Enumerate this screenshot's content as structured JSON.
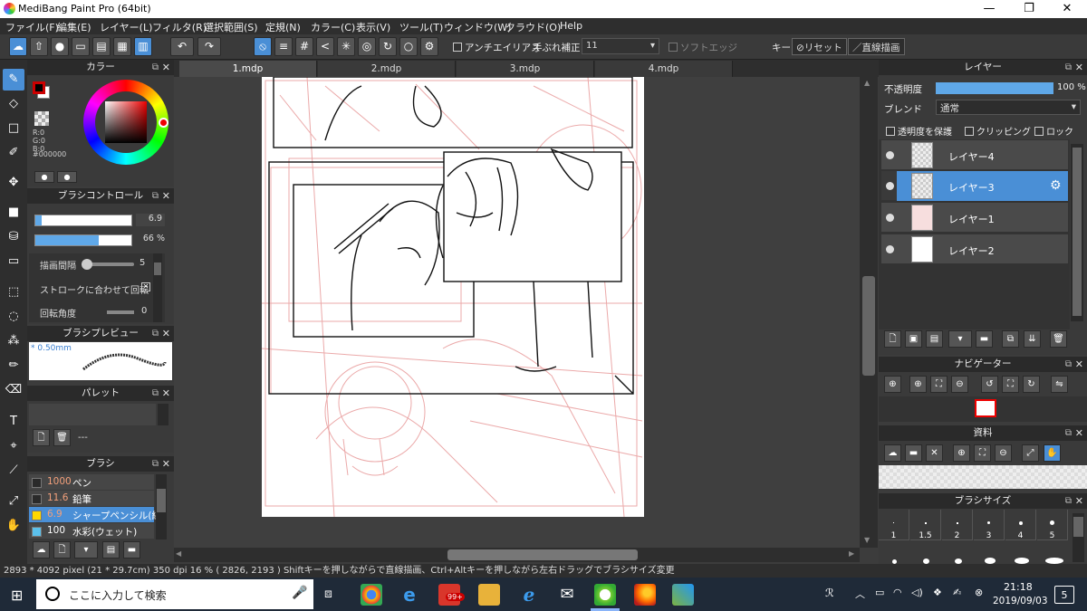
{
  "window": {
    "title": "MediBang Paint Pro (64bit)",
    "minimize": "—",
    "maximize": "❐",
    "close": "✕"
  },
  "menu": [
    "ファイル(F)",
    "編集(E)",
    "レイヤー(L)",
    "フィルタ(R)",
    "選択範囲(S)",
    "定規(N)",
    "カラー(C)",
    "表示(V)",
    "ツール(T)",
    "ウィンドウ(W)",
    "クラウド(O)",
    "Help"
  ],
  "toolbar": {
    "antialias": "アンチエイリアス",
    "stabilizer_label": "手ぶれ補正",
    "stabilizer_value": "11",
    "soft_edge": "ソフトエッジ",
    "key_label": "キー",
    "reset": "リセット",
    "line_draw": "直線描画"
  },
  "tabs": [
    "1.mdp",
    "2.mdp",
    "3.mdp",
    "4.mdp"
  ],
  "color_panel": {
    "title": "カラー",
    "r": "R:0",
    "g": "G:0",
    "b": "B:0",
    "hex": "#000000",
    "foreground": "#cc0000",
    "background": "#ffffff"
  },
  "brush_control": {
    "title": "ブラシコントロール",
    "size": "6.9",
    "opacity": "66",
    "opacity_unit": "%",
    "opacity_fraction": 0.66,
    "size_fraction": 0.07,
    "spacing_label": "描画間隔",
    "spacing_value": "5",
    "rotate_label": "ストロークに合わせて回転",
    "angle_label": "回転角度",
    "angle_value": "0"
  },
  "brush_preview": {
    "title": "ブラシプレビュー",
    "size_label": "* 0.50mm"
  },
  "palette": {
    "title": "パレット",
    "dash": "---"
  },
  "brush_list": {
    "title": "ブラシ",
    "items": [
      {
        "size": "1000",
        "name": "ペン",
        "color": "#2a2a2a"
      },
      {
        "size": "11.6",
        "name": "鉛筆",
        "color": "#2a2a2a"
      },
      {
        "size": "6.9",
        "name": "シャープペンシル(線)",
        "color": "#ffd700"
      },
      {
        "size": "100",
        "name": "水彩(ウェット)",
        "color": "#5bc0eb"
      }
    ]
  },
  "layers": {
    "title": "レイヤー",
    "opacity_label": "不透明度",
    "opacity_value": "100",
    "opacity_unit": "%",
    "opacity_fraction": 1.0,
    "blend_label": "ブレンド",
    "blend_value": "通常",
    "protect": "透明度を保護",
    "clipping": "クリッピング",
    "lock": "ロック",
    "items": [
      {
        "name": "レイヤー4",
        "selected": false
      },
      {
        "name": "レイヤー3",
        "selected": true
      },
      {
        "name": "レイヤー1",
        "selected": false
      },
      {
        "name": "レイヤー2",
        "selected": false
      }
    ]
  },
  "navigator": {
    "title": "ナビゲーター"
  },
  "material": {
    "title": "資料"
  },
  "brush_size": {
    "title": "ブラシサイズ",
    "sizes": [
      "1",
      "1.5",
      "2",
      "3",
      "4",
      "5"
    ]
  },
  "status": {
    "text": "2893 * 4092 pixel  (21 * 29.7cm)  350 dpi  16 %  ( 2826, 2193 )  Shiftキーを押しながらで直線描画、Ctrl+Altキーを押しながら左右ドラッグでブラシサイズ変更"
  },
  "taskbar": {
    "search_placeholder": "ここに入力して検索",
    "badge": "99+",
    "time": "21:18",
    "date": "2019/09/03",
    "notifications": "5"
  }
}
